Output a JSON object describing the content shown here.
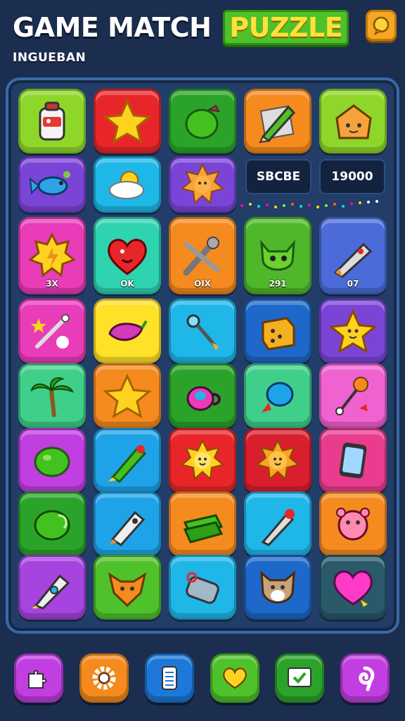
{
  "header": {
    "title_main": "GAME MATCH",
    "title_accent": "PUZZLE",
    "subtitle": "INGUEBAN",
    "chat_icon": "chat-bubble-icon"
  },
  "score_panel": {
    "label": "SBCBE",
    "value": "19000"
  },
  "tile_labels": {
    "r2c0": "3X",
    "r2c1": "OK",
    "r2c2": "OIX",
    "r2c3": "291",
    "r2c4": "07"
  },
  "board": {
    "rows": [
      [
        "battery-jar-icon",
        "star-icon",
        "lime-icon",
        "pencil-icon",
        "toast-icon"
      ],
      [
        "fish-icon",
        "sun-cloud-icon",
        "sun-face-icon",
        "score",
        "score"
      ],
      [
        "star-badge-icon",
        "heart-face-icon",
        "wrench-icon",
        "cat-face-icon",
        "rocket-controller-icon"
      ],
      [
        "magic-wand-icon",
        "chili-pepper-icon",
        "key-icon",
        "dice-icon",
        "star-face-icon"
      ],
      [
        "palm-tree-icon",
        "star-icon",
        "teapot-icon",
        "balloon-icon",
        "maracas-icon"
      ],
      [
        "lime-icon",
        "rocket-icon",
        "sun-face-icon",
        "sun-face-icon",
        "phone-icon"
      ],
      [
        "lime-icon",
        "remote-icon",
        "money-stack-icon",
        "marker-icon",
        "pig-face-icon"
      ],
      [
        "rocket-ship-icon",
        "fox-face-icon",
        "can-icon",
        "dog-face-icon",
        "heart-icon"
      ]
    ]
  },
  "colors": {
    "background": "#1b2e4f",
    "accent_green": "#4fc12a",
    "accent_yellow": "#ffe13a"
  },
  "toolbar": {
    "buttons": [
      "puzzle-piece-icon",
      "gear-icon",
      "list-icon",
      "heart-speech-icon",
      "screen-check-icon",
      "swirl-icon"
    ]
  }
}
